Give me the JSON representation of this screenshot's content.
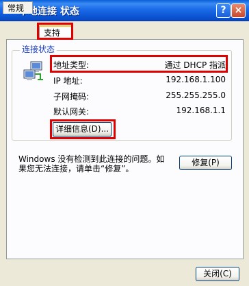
{
  "window": {
    "title": "本地连接 状态",
    "help_label": "?",
    "close_label": "×"
  },
  "tabs": [
    {
      "label": "常规",
      "selected": false
    },
    {
      "label": "支持",
      "selected": true
    }
  ],
  "connection_status": {
    "group_label": "连接状态",
    "rows": [
      {
        "label": "地址类型:",
        "value": "通过 DHCP 指派"
      },
      {
        "label": "IP 地址:",
        "value": "192.168.1.100"
      },
      {
        "label": "子网掩码:",
        "value": "255.255.255.0"
      },
      {
        "label": "默认网关:",
        "value": "192.168.1.1"
      }
    ],
    "details_button": "详细信息(D)..."
  },
  "repair": {
    "message": "Windows 没有检测到此连接的问题。如果您无法连接，请单击“修复”。",
    "button": "修复(P)"
  },
  "footer": {
    "close_button": "关闭(C)"
  },
  "colors": {
    "highlight": "#E00000",
    "group_label": "#1E43C8",
    "titlebar": "#0B55D3"
  }
}
